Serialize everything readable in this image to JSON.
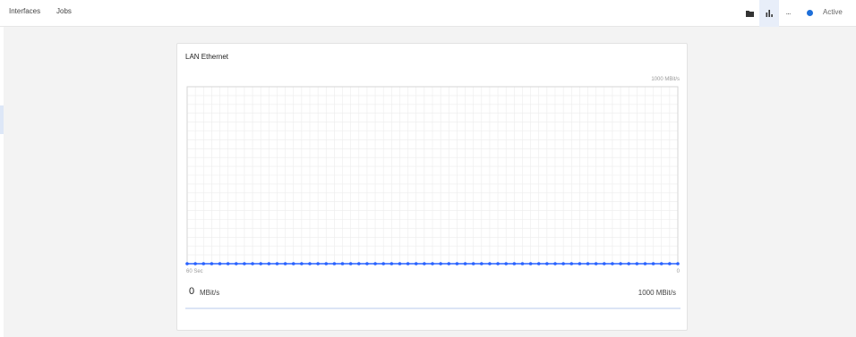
{
  "nav": {
    "interfaces": "Interfaces",
    "jobs": "Jobs"
  },
  "toolbar": {
    "folder_icon": "folder-icon",
    "chart_icon": "bar-chart-icon",
    "more_icon": "more-icon",
    "more_glyph": "···",
    "status_label": "Active",
    "status_color": "#1e6fd9"
  },
  "card": {
    "title": "LAN Ethernet",
    "max_speed_label": "1000 MBit/s",
    "current_value": "0",
    "current_unit": "MBit/s",
    "current_fraction": 0
  },
  "chart_data": {
    "type": "line",
    "title": "LAN Ethernet",
    "y_top_label": "1000 MBit/s",
    "x_left_label": "60 Sec",
    "x_right_label": "0",
    "ylim": [
      0,
      1000
    ],
    "xlim": [
      60,
      0
    ],
    "grid": true,
    "line_color": "#2962ff",
    "series": [
      {
        "x": [
          60,
          59,
          58,
          57,
          56,
          55,
          54,
          53,
          52,
          51,
          50,
          49,
          48,
          47,
          46,
          45,
          44,
          43,
          42,
          41,
          40,
          39,
          38,
          37,
          36,
          35,
          34,
          33,
          32,
          31,
          30,
          29,
          28,
          27,
          26,
          25,
          24,
          23,
          22,
          21,
          20,
          19,
          18,
          17,
          16,
          15,
          14,
          13,
          12,
          11,
          10,
          9,
          8,
          7,
          6,
          5,
          4,
          3,
          2,
          1,
          0
        ],
        "values": [
          0,
          0,
          0,
          0,
          0,
          0,
          0,
          0,
          0,
          0,
          0,
          0,
          0,
          0,
          0,
          0,
          0,
          0,
          0,
          0,
          0,
          0,
          0,
          0,
          0,
          0,
          0,
          0,
          0,
          0,
          0,
          0,
          0,
          0,
          0,
          0,
          0,
          0,
          0,
          0,
          0,
          0,
          0,
          0,
          0,
          0,
          0,
          0,
          0,
          0,
          0,
          0,
          0,
          0,
          0,
          0,
          0,
          0,
          0,
          0,
          0
        ]
      }
    ]
  }
}
